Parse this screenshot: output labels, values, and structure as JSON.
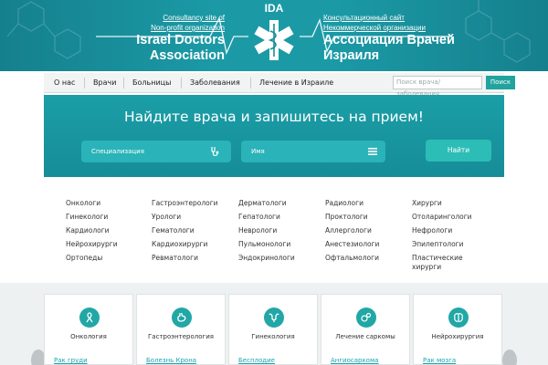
{
  "header": {
    "left_sub": "Consultancy site of Non-profit organization",
    "left_sub_1": "Consultancy site of",
    "left_sub_2": "Non-profit organization",
    "left_title_1": "Israel Doctors",
    "left_title_2": "Association",
    "right_sub_1": "Консультационный сайт",
    "right_sub_2": "Некоммерческой организации",
    "right_title_1": "Ассоциация Врачей",
    "right_title_2": "Израиля",
    "logo_text": "IDA"
  },
  "nav": {
    "items": [
      "О нас",
      "Врачи",
      "Больницы",
      "Заболевания",
      "Лечение в Израиле"
    ],
    "search_placeholder": "Поиск врача/заболевания",
    "search_button": "Поиск"
  },
  "hero": {
    "title": "Найдите врача и запишитесь на прием!",
    "specialization_placeholder": "Специализация",
    "name_placeholder": "Имя",
    "find_button": "Найти"
  },
  "categories": {
    "col1": [
      "Онкологи",
      "Гинекологи",
      "Кардиологи",
      "Нейрохирурги",
      "Ортопеды"
    ],
    "col2": [
      "Гастроэнтерологи",
      "Урологи",
      "Гематологи",
      "Кардиохирурги",
      "Ревматологи"
    ],
    "col3": [
      "Дерматологи",
      "Гепатологи",
      "Неврологи",
      "Пульмонологи",
      "Эндокринологи"
    ],
    "col4": [
      "Радиологи",
      "Проктологи",
      "Аллергологи",
      "Анестезиологи",
      "Офтальмологи"
    ],
    "col5": [
      "Хирурги",
      "Отоларингологи",
      "Нефрологи",
      "Эпилептологи",
      "Пластические",
      "хирурги"
    ]
  },
  "cards": [
    {
      "title": "Онкология",
      "link": "Рак груди",
      "icon": "ribbon-icon"
    },
    {
      "title": "Гастроэнтерология",
      "link": "Болезнь Крона",
      "icon": "stomach-icon"
    },
    {
      "title": "Гинекология",
      "link": "Бесплодие",
      "icon": "uterus-icon"
    },
    {
      "title": "Лечение саркомы",
      "link": "Ангиосаркома",
      "icon": "cells-icon"
    },
    {
      "title": "Нейрохирургия",
      "link": "Рак мозга",
      "icon": "brain-icon"
    }
  ],
  "colors": {
    "brand": "#1b9aa6",
    "accent": "#21a7a6",
    "link": "#1aa3b1"
  }
}
